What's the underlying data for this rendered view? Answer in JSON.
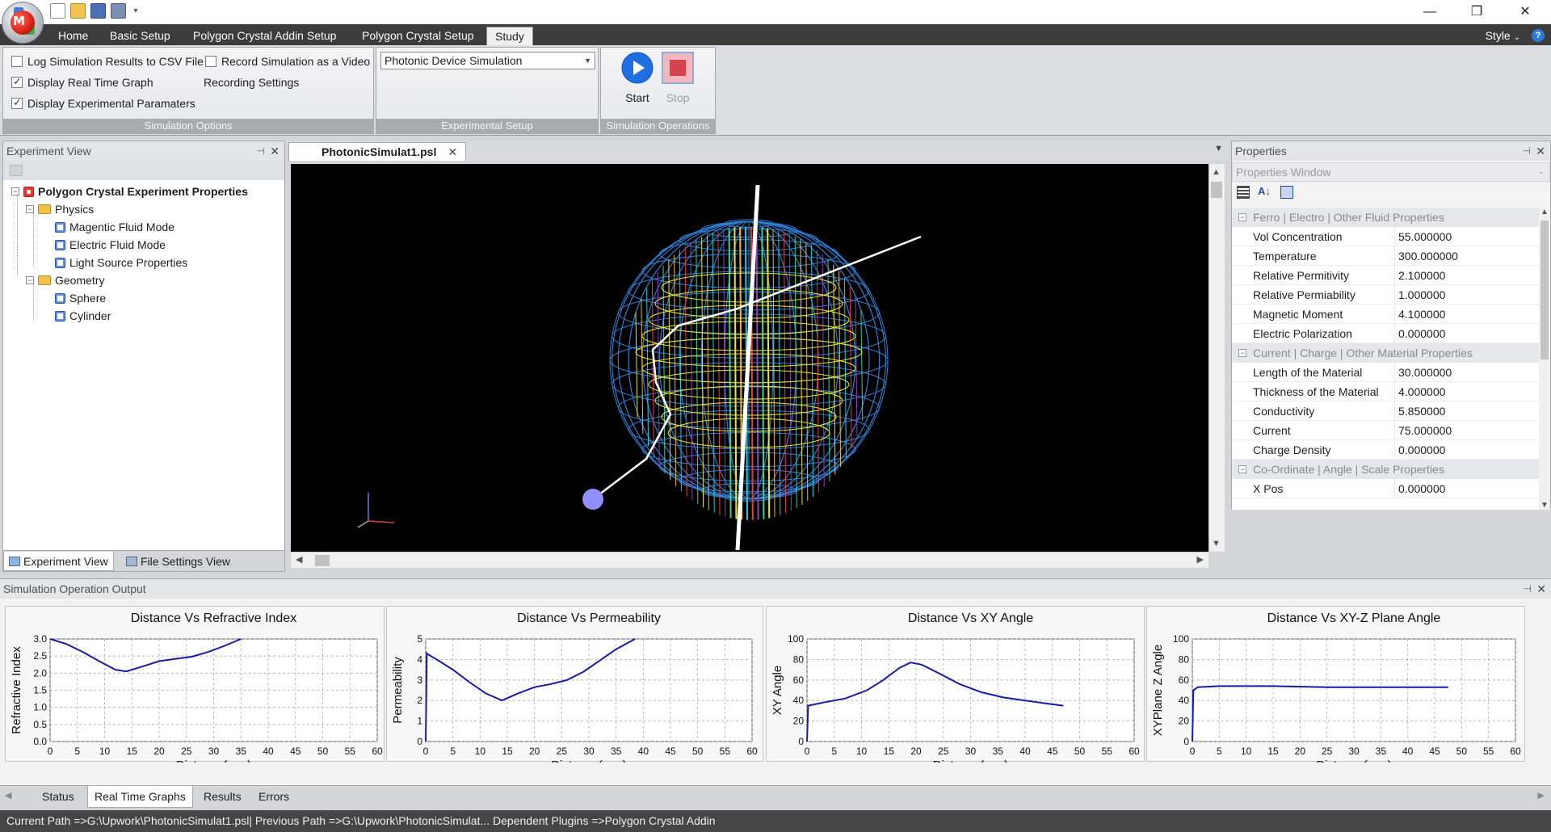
{
  "ribbon": {
    "tabs": [
      "Home",
      "Basic Setup",
      "Polygon Crystal Addin Setup",
      "Polygon Crystal Setup",
      "Study"
    ],
    "style_label": "Style",
    "groups": {
      "simulation_options": {
        "title": "Simulation Options",
        "log_csv": "Log Simulation Results to CSV File",
        "record_video": "Record Simulation as a Video",
        "display_graph": "Display Real Time Graph",
        "recording_settings": "Recording Settings",
        "display_params": "Display Experimental Paramaters"
      },
      "experimental_setup": {
        "title": "Experimental Setup",
        "selected": "Photonic Device Simulation"
      },
      "simulation_operations": {
        "title": "Simulation Operations",
        "start": "Start",
        "stop": "Stop"
      }
    }
  },
  "experiment_view": {
    "title": "Experiment View",
    "tree": {
      "root": "Polygon Crystal Experiment Properties",
      "physics": "Physics",
      "magnetic": "Magentic Fluid Mode",
      "electric": "Electric Fluid Mode",
      "light": "Light Source Properties",
      "geometry": "Geometry",
      "sphere": "Sphere",
      "cylinder": "Cylinder"
    },
    "tabs": [
      "Experiment View",
      "File Settings View"
    ]
  },
  "document": {
    "tab": "PhotonicSimulat1.psl"
  },
  "properties": {
    "title": "Properties",
    "window_label": "Properties Window",
    "categories": [
      {
        "name": "Ferro | Electro | Other Fluid Properties",
        "rows": [
          [
            "Vol Concentration",
            "55.000000"
          ],
          [
            "Temperature",
            "300.000000"
          ],
          [
            "Relative Permitivity",
            "2.100000"
          ],
          [
            "Relative Permiability",
            "1.000000"
          ],
          [
            "Magnetic Moment",
            "4.100000"
          ],
          [
            "Electric Polarization",
            "0.000000"
          ]
        ]
      },
      {
        "name": "Current | Charge | Other Material Properties",
        "rows": [
          [
            "Length of the Material",
            "30.000000"
          ],
          [
            "Thickness of the Material",
            "4.000000"
          ],
          [
            "Conductivity",
            "5.850000"
          ],
          [
            "Current",
            "75.000000"
          ],
          [
            "Charge Density",
            "0.000000"
          ]
        ]
      },
      {
        "name": "Co-Ordinate | Angle | Scale Properties",
        "rows": [
          [
            "X Pos",
            "0.000000"
          ]
        ]
      }
    ]
  },
  "output": {
    "title": "Simulation Operation Output",
    "tabs": [
      "Status",
      "Real Time Graphs",
      "Results",
      "Errors"
    ]
  },
  "status_bar": {
    "text": "Current Path =>G:\\Upwork\\PhotonicSimulat1.psl| Previous Path =>G:\\Upwork\\PhotonicSimulat...   Dependent Plugins =>Polygon Crystal Addin"
  },
  "chart_data": [
    {
      "type": "line",
      "title": "Distance Vs Refractive Index",
      "xlabel": "Distance(mm)",
      "ylabel": "Refractive Index",
      "xlim": [
        0,
        60
      ],
      "ylim": [
        0,
        3.0
      ],
      "xticks": [
        0,
        5,
        10,
        15,
        20,
        25,
        30,
        35,
        40,
        45,
        50,
        55,
        60
      ],
      "yticks": [
        "0.0",
        "0.5",
        "1.0",
        "1.5",
        "2.0",
        "2.5",
        "3.0"
      ],
      "grid": true,
      "series": [
        {
          "color": "#1a1aa6",
          "x": [
            0,
            3,
            6,
            9,
            12,
            14,
            17,
            20,
            23,
            26,
            29,
            32,
            35
          ],
          "y": [
            3.0,
            2.85,
            2.62,
            2.35,
            2.1,
            2.05,
            2.2,
            2.35,
            2.42,
            2.48,
            2.62,
            2.8,
            3.0
          ]
        }
      ]
    },
    {
      "type": "line",
      "title": "Distance Vs Permeability",
      "xlabel": "Distance(mm)",
      "ylabel": "Permeability",
      "xlim": [
        0,
        60
      ],
      "ylim": [
        0,
        5
      ],
      "xticks": [
        0,
        5,
        10,
        15,
        20,
        25,
        30,
        35,
        40,
        45,
        50,
        55,
        60
      ],
      "yticks": [
        "0",
        "1",
        "2",
        "3",
        "4",
        "5"
      ],
      "grid": true,
      "series": [
        {
          "color": "#1a1aa6",
          "x": [
            0,
            0.2,
            0.4,
            2,
            5,
            8,
            11,
            14,
            17,
            20,
            23,
            26,
            29,
            32,
            35,
            38.5
          ],
          "y": [
            0,
            4.3,
            4.25,
            4.0,
            3.5,
            2.9,
            2.35,
            2.0,
            2.35,
            2.65,
            2.8,
            3.0,
            3.4,
            3.95,
            4.5,
            5.0
          ]
        }
      ]
    },
    {
      "type": "line",
      "title": "Distance Vs XY Angle",
      "xlabel": "Distance(mm)",
      "ylabel": "XY Angle",
      "xlim": [
        0,
        60
      ],
      "ylim": [
        0,
        100
      ],
      "xticks": [
        0,
        5,
        10,
        15,
        20,
        25,
        30,
        35,
        40,
        45,
        50,
        55,
        60
      ],
      "yticks": [
        "0",
        "20",
        "40",
        "60",
        "80",
        "100"
      ],
      "grid": true,
      "series": [
        {
          "color": "#1a1aa6",
          "x": [
            0,
            0.2,
            3,
            7,
            11,
            14,
            17,
            19,
            21,
            24,
            28,
            32,
            36,
            40,
            44,
            47
          ],
          "y": [
            0,
            35,
            38,
            42,
            50,
            60,
            72,
            77,
            75,
            67,
            56,
            48,
            43,
            40,
            37,
            35
          ]
        }
      ]
    },
    {
      "type": "line",
      "title": "Distance Vs XY-Z Plane Angle",
      "xlabel": "Distance(mm)",
      "ylabel": "XYPlane Z Angle",
      "xlim": [
        0,
        60
      ],
      "ylim": [
        0,
        100
      ],
      "xticks": [
        0,
        5,
        10,
        15,
        20,
        25,
        30,
        35,
        40,
        45,
        50,
        55,
        60
      ],
      "yticks": [
        "0",
        "20",
        "40",
        "60",
        "80",
        "100"
      ],
      "grid": true,
      "series": [
        {
          "color": "#1a1aa6",
          "x": [
            0,
            0.2,
            1,
            5,
            15,
            25,
            35,
            47.5
          ],
          "y": [
            0,
            50,
            53,
            54,
            54,
            53,
            53,
            53
          ]
        }
      ]
    }
  ]
}
